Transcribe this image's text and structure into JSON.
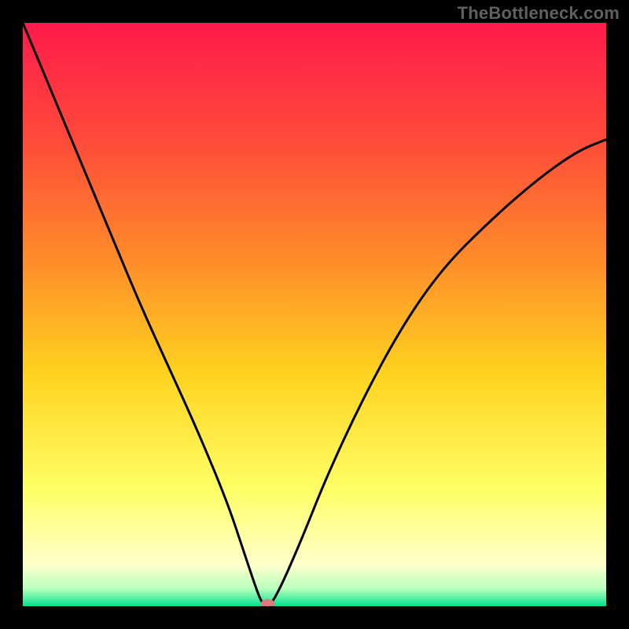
{
  "watermark": "TheBottleneck.com",
  "chart_data": {
    "type": "line",
    "title": "",
    "xlabel": "",
    "ylabel": "",
    "xlim": [
      0,
      100
    ],
    "ylim": [
      0,
      100
    ],
    "grid": false,
    "background_gradient_stops": [
      {
        "pos": 0.0,
        "color": "#ff1a4b"
      },
      {
        "pos": 0.2,
        "color": "#ff4a3a"
      },
      {
        "pos": 0.4,
        "color": "#ff8a2a"
      },
      {
        "pos": 0.6,
        "color": "#ffd21f"
      },
      {
        "pos": 0.8,
        "color": "#ffff66"
      },
      {
        "pos": 0.93,
        "color": "#ffffcc"
      },
      {
        "pos": 0.97,
        "color": "#b8ffbd"
      },
      {
        "pos": 1.0,
        "color": "#00e38d"
      }
    ],
    "series": [
      {
        "name": "bottleneck-curve",
        "x": [
          0,
          5,
          10,
          15,
          20,
          25,
          30,
          35,
          38,
          40,
          41,
          42,
          43,
          45,
          48,
          52,
          58,
          65,
          72,
          80,
          88,
          95,
          100
        ],
        "y": [
          100,
          88,
          76,
          64,
          52,
          41,
          30,
          18,
          9,
          3,
          0.5,
          0,
          1,
          5,
          12,
          22,
          35,
          48,
          58,
          66,
          73,
          78,
          80
        ]
      }
    ],
    "marker": {
      "name": "minimum-point",
      "x": 42,
      "y": 0,
      "color": "#d97a7f"
    }
  }
}
